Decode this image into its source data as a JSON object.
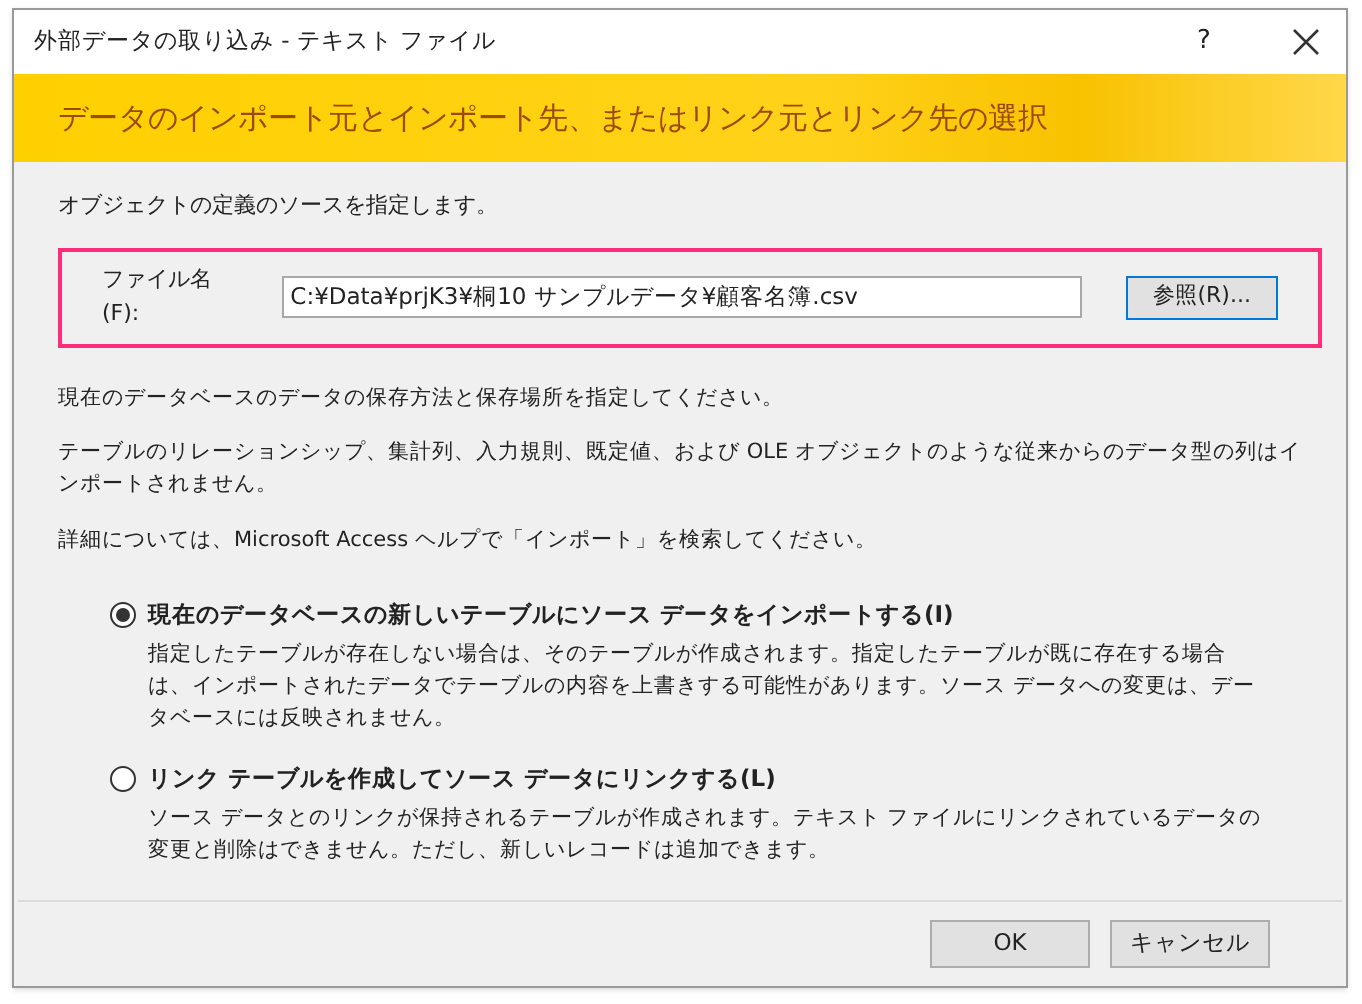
{
  "window": {
    "title": "外部データの取り込み - テキスト ファイル",
    "help": "?"
  },
  "banner": {
    "title": "データのインポート元とインポート先、またはリンク元とリンク先の選択"
  },
  "source_prompt": "オブジェクトの定義のソースを指定します。",
  "file": {
    "label": "ファイル名(F):",
    "value": "C:¥Data¥prjK3¥桐10 サンプルデータ¥顧客名簿.csv",
    "browse": "参照(R)..."
  },
  "paragraphs": [
    "現在のデータベースのデータの保存方法と保存場所を指定してください。",
    "テーブルのリレーションシップ、集計列、入力規則、既定値、および OLE オブジェクトのような従来からのデータ型の列はインポートされません。",
    "詳細については、Microsoft Access ヘルプで「インポート」を検索してください。"
  ],
  "options": [
    {
      "label": "現在のデータベースの新しいテーブルにソース データをインポートする(I)",
      "description": "指定したテーブルが存在しない場合は、そのテーブルが作成されます。指定したテーブルが既に存在する場合は、インポートされたデータでテーブルの内容を上書きする可能性があります。ソース データへの変更は、データベースには反映されません。",
      "selected": true
    },
    {
      "label": "リンク テーブルを作成してソース データにリンクする(L)",
      "description": "ソース データとのリンクが保持されるテーブルが作成されます。テキスト ファイルにリンクされているデータの変更と削除はできません。ただし、新しいレコードは追加できます。",
      "selected": false
    }
  ],
  "buttons": [
    "OK",
    "キャンセル"
  ]
}
